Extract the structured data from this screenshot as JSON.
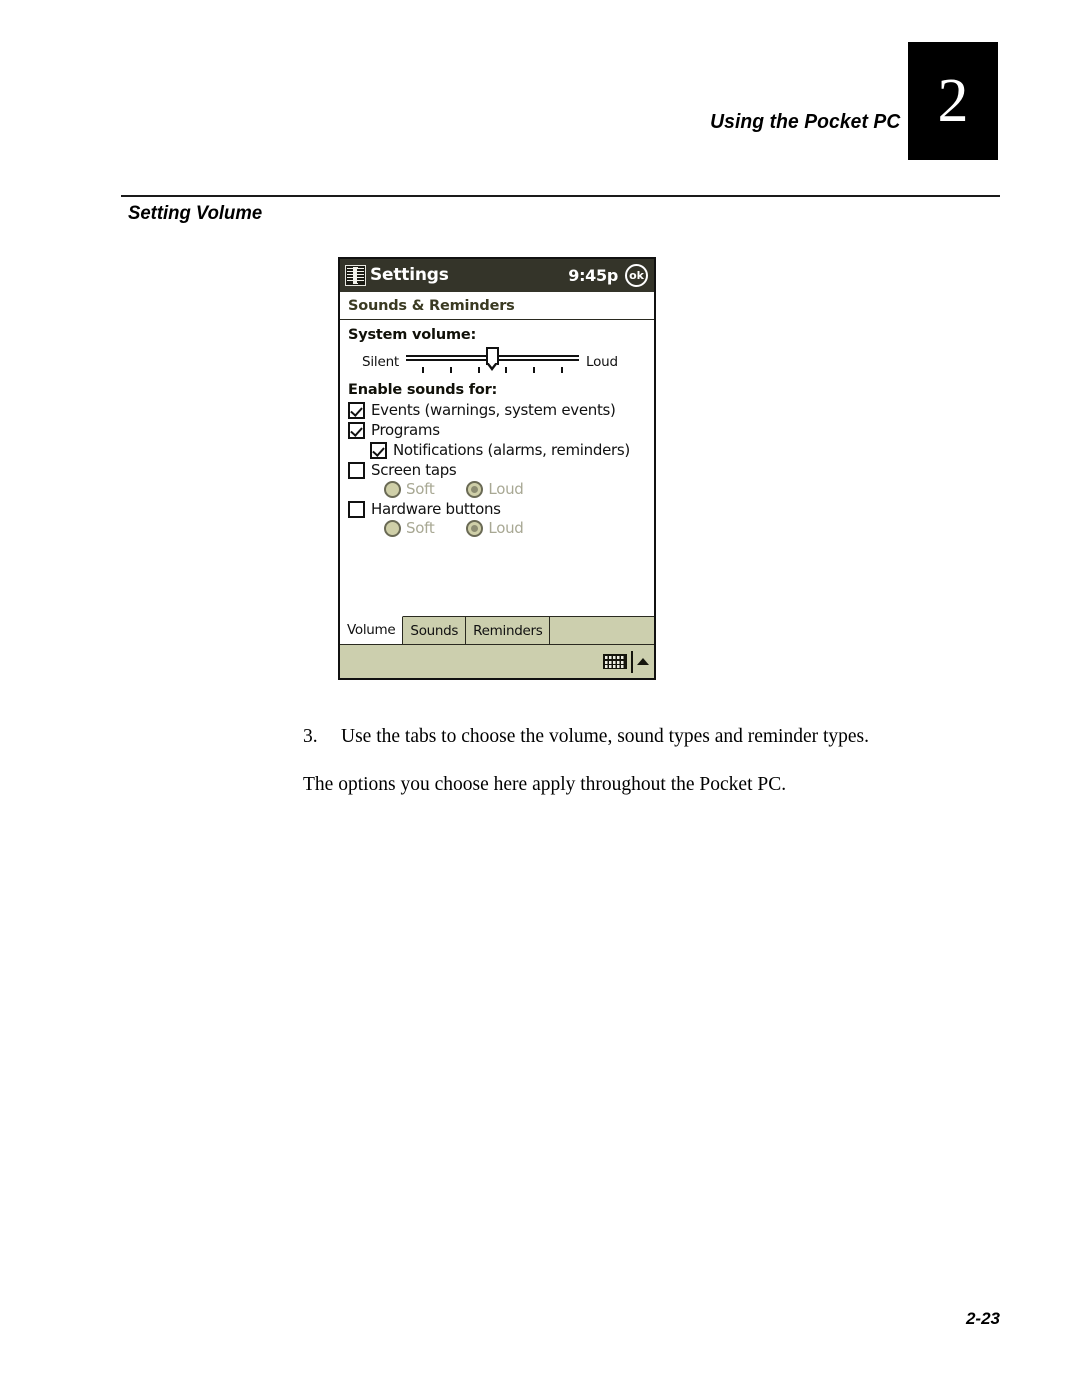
{
  "page_header": {
    "chapter_title": "Using the Pocket PC",
    "chapter_number": "2"
  },
  "section": {
    "heading": "Setting Volume"
  },
  "pda": {
    "titlebar": {
      "app_icon": "settings-book-icon",
      "title": "Settings",
      "clock": "9:45p",
      "ok_label": "ok"
    },
    "subtitle": "Sounds & Reminders",
    "system_volume": {
      "label": "System volume:",
      "min_label": "Silent",
      "max_label": "Loud",
      "thumb_position_percent": 50,
      "tick_count": 6
    },
    "enable_sounds": {
      "label": "Enable sounds for:",
      "checkboxes": [
        {
          "label": "Events (warnings, system events)",
          "checked": true,
          "indent": 0
        },
        {
          "label": "Programs",
          "checked": true,
          "indent": 0
        },
        {
          "label": "Notifications (alarms, reminders)",
          "checked": true,
          "indent": 1
        },
        {
          "label": "Screen taps",
          "checked": false,
          "indent": 0
        },
        {
          "label": "Hardware buttons",
          "checked": false,
          "indent": 0
        }
      ],
      "screen_taps_radios": [
        {
          "label": "Soft",
          "selected": false
        },
        {
          "label": "Loud",
          "selected": true
        }
      ],
      "hardware_buttons_radios": [
        {
          "label": "Soft",
          "selected": false
        },
        {
          "label": "Loud",
          "selected": true
        }
      ]
    },
    "tabs": [
      {
        "label": "Volume",
        "active": true
      },
      {
        "label": "Sounds",
        "active": false
      },
      {
        "label": "Reminders",
        "active": false
      }
    ],
    "toolbar": {
      "keyboard_icon": "keyboard-icon",
      "arrow_icon": "input-panel-arrow-icon"
    },
    "colors": {
      "titlebar": "#343429",
      "chrome_khaki": "#cccfae",
      "subtitle_text": "#3a3a22",
      "disabled_text": "#a8a894",
      "radio_fill": "#cfcfa8"
    }
  },
  "body": {
    "step_number": "3.",
    "step_text": "Use the tabs to choose the volume, sound types and reminder types.",
    "followup_text": "The options you choose here apply throughout the Pocket PC."
  },
  "footer": {
    "page_number": "2-23"
  }
}
